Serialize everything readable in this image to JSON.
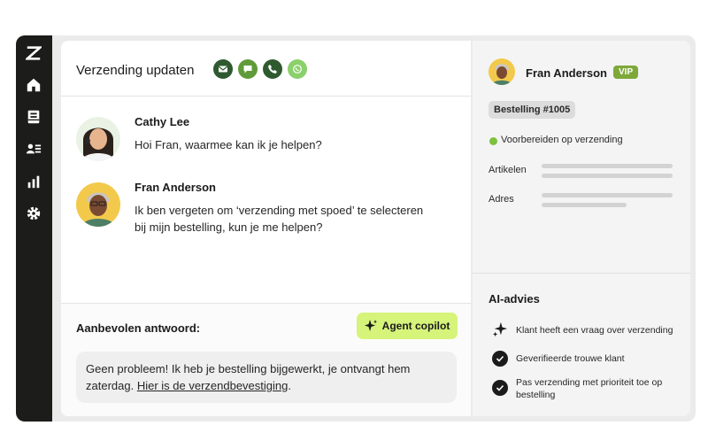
{
  "conversation": {
    "title": "Verzending updaten",
    "channels": [
      "email-icon",
      "chat-icon",
      "phone-icon",
      "whatsapp-icon"
    ],
    "messages": [
      {
        "sender": "Cathy Lee",
        "text": "Hoi Fran, waarmee kan ik je helpen?"
      },
      {
        "sender": "Fran Anderson",
        "text": "Ik ben vergeten om ‘verzending met spoed’ te selecteren bij mijn bestelling, kun je me helpen?"
      }
    ]
  },
  "suggestion": {
    "label": "Aanbevolen antwoord:",
    "copilot_label": "Agent copilot",
    "reply_text": "Geen probleem! Ik heb je bestelling bijgewerkt, je ontvangt hem zaterdag. ",
    "reply_link": "Hier is de verzendbevestiging",
    "reply_end": "."
  },
  "customer": {
    "name": "Fran Anderson",
    "badge": "VIP",
    "order": "Bestelling #1005",
    "status": "Voorbereiden op verzending",
    "fields": [
      "Artikelen",
      "Adres"
    ]
  },
  "ai": {
    "title": "AI-advies",
    "items": [
      {
        "icon": "sparkle-icon",
        "text": "Klant heeft een vraag over verzending"
      },
      {
        "icon": "check-icon",
        "text": "Geverifieerde trouwe klant"
      },
      {
        "icon": "check-icon",
        "text": "Pas verzending met prioriteit toe op bestelling"
      }
    ]
  },
  "colors": {
    "sidebar": "#1c1d1a",
    "accent_green": "#d6f37a",
    "vip": "#7ea83a",
    "status": "#7dc13c"
  }
}
